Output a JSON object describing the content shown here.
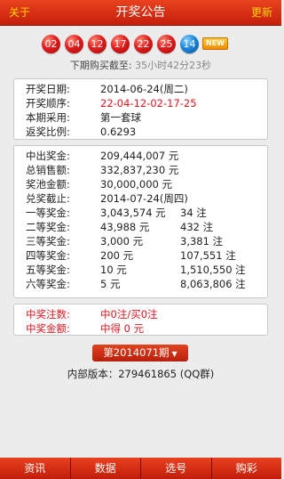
{
  "header": {
    "left": "关于",
    "title": "开奖公告",
    "right": "更新"
  },
  "balls": {
    "red": [
      "02",
      "04",
      "12",
      "17",
      "22",
      "25"
    ],
    "blue": "14",
    "badge": "NEW"
  },
  "countdown": {
    "label": "下期购买截至:",
    "time": "35小时42分23秒"
  },
  "draw_info": {
    "date_label": "开奖日期:",
    "date": "2014-06-24(周二)",
    "order_label": "开奖顺序:",
    "order": "22-04-12-02-17-25",
    "set_label": "本期采用:",
    "set": "第一套球",
    "ratio_label": "返奖比例:",
    "ratio": "0.6293"
  },
  "prize_info": {
    "payout_label": "中出奖金:",
    "payout": "209,444,007 元",
    "sales_label": "总销售额:",
    "sales": "332,837,230 元",
    "pool_label": "奖池金额:",
    "pool": "30,000,000 元",
    "deadline_label": "兑奖截止:",
    "deadline": "2014-07-24(周四)",
    "tiers": [
      {
        "label": "一等奖金:",
        "amount": "3,043,574 元",
        "count": "34 注"
      },
      {
        "label": "二等奖金:",
        "amount": "43,988 元",
        "count": "432 注"
      },
      {
        "label": "三等奖金:",
        "amount": "3,000 元",
        "count": "3,381 注"
      },
      {
        "label": "四等奖金:",
        "amount": "200 元",
        "count": "107,551 注"
      },
      {
        "label": "五等奖金:",
        "amount": "10 元",
        "count": "1,510,550 注"
      },
      {
        "label": "六等奖金:",
        "amount": "5 元",
        "count": "8,063,806 注"
      }
    ]
  },
  "user_result": {
    "count_label": "中奖注数:",
    "count": "中0注/买0注",
    "amount_label": "中奖金额:",
    "amount": "中得 0 元"
  },
  "period_selector": {
    "label": "第2014071期",
    "caret": "▼"
  },
  "version": "内部版本：279461865 (QQ群)",
  "bottom_tabs": [
    "资讯",
    "数据",
    "选号",
    "购彩"
  ]
}
